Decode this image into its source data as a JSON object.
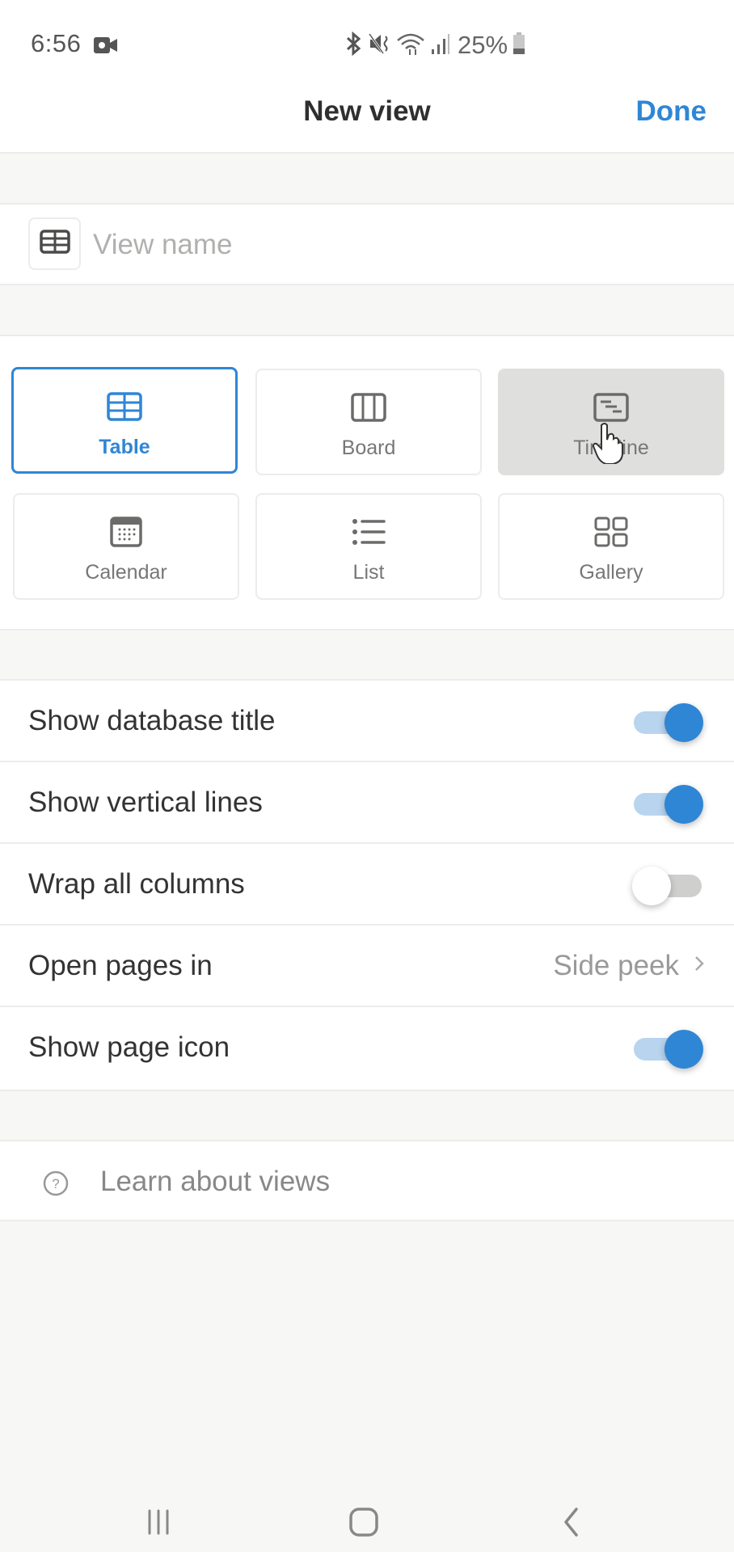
{
  "status_bar": {
    "time": "6:56",
    "battery_percent": "25%",
    "icons": [
      "screen-record-icon",
      "bluetooth-icon",
      "mute-icon",
      "wifi-icon",
      "signal-icon",
      "battery-icon"
    ]
  },
  "header": {
    "title": "New view",
    "done_label": "Done"
  },
  "name_field": {
    "value": "",
    "placeholder": "View name",
    "icon": "table-icon"
  },
  "view_types": [
    {
      "label": "Table",
      "icon": "table-icon",
      "selected": true
    },
    {
      "label": "Board",
      "icon": "board-icon",
      "selected": false
    },
    {
      "label": "Timeline",
      "icon": "timeline-icon",
      "selected": false,
      "pressed": true
    },
    {
      "label": "Calendar",
      "icon": "calendar-icon",
      "selected": false
    },
    {
      "label": "List",
      "icon": "list-icon",
      "selected": false
    },
    {
      "label": "Gallery",
      "icon": "gallery-icon",
      "selected": false
    }
  ],
  "settings": [
    {
      "label": "Show database title",
      "type": "toggle",
      "on": true
    },
    {
      "label": "Show vertical lines",
      "type": "toggle",
      "on": true
    },
    {
      "label": "Wrap all columns",
      "type": "toggle",
      "on": false
    },
    {
      "label": "Open pages in",
      "type": "select",
      "value": "Side peek"
    },
    {
      "label": "Show page icon",
      "type": "toggle",
      "on": true
    }
  ],
  "learn_link": {
    "label": "Learn about views",
    "icon": "help-circle-icon"
  },
  "colors": {
    "accent": "#2f86d5",
    "toggle_track_on": "#b9d4ee",
    "background": "#f7f7f5"
  },
  "nav_bar": [
    "recent-apps-icon",
    "home-icon",
    "back-icon"
  ]
}
